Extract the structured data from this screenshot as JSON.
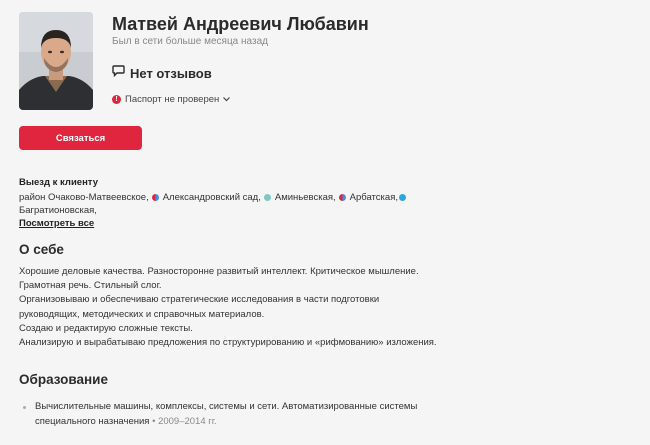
{
  "profile": {
    "name": "Матвей Андреевич Любавин",
    "last_seen": "Был в сети больше месяца назад",
    "reviews": "Нет отзывов",
    "passport_status": "Паспорт не проверен",
    "contact_button": "Связаться"
  },
  "visit": {
    "title": "Выезд к клиенту",
    "line1_prefix": "район Очаково-Матвеевское,",
    "stations": [
      {
        "name": "Александровский сад,",
        "color": "#4a90d9"
      },
      {
        "name": "Аминьевская,",
        "color": "#7fc6c4"
      },
      {
        "name": "Арбатская,",
        "color": "#4a90d9"
      },
      {
        "name": "",
        "color": "#29a9e0"
      }
    ],
    "line2": "Багратионовская,",
    "see_all": "Посмотреть все"
  },
  "about": {
    "title": "О себе",
    "lines": [
      "Хорошие деловые качества. Разносторонне развитый интеллект. Критическое мышление.",
      "Грамотная речь. Стильный слог.",
      "Организовываю и обеспечиваю стратегические исследования в части подготовки",
      "руководящих, методических и справочных материалов.",
      "Создаю и редактирую сложные тексты.",
      "Анализирую и вырабатываю предложения по структурированию и «рифмованию» изложения."
    ]
  },
  "education": {
    "title": "Образование",
    "item_line1": "Вычислительные машины, комплексы, системы и сети. Автоматизированные системы",
    "item_line2": "специального назначения",
    "item_sep": "•",
    "item_years": "2009–2014 гг."
  },
  "colors": {
    "accent": "#e0253f",
    "background": "#f5f5f5"
  }
}
